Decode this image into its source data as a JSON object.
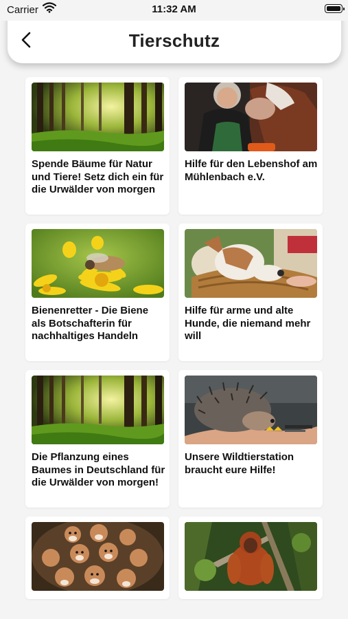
{
  "status_bar": {
    "carrier": "Carrier",
    "time": "11:32 AM"
  },
  "nav": {
    "title": "Tierschutz"
  },
  "cards": [
    {
      "title": "Spende Bäume für Natur und Tiere! Setz dich ein für die Urwälder von morgen",
      "image": "forest"
    },
    {
      "title": "Hilfe für den Lebenshof am Mühlenbach e.V.",
      "image": "man-with-cow"
    },
    {
      "title": "Bienenretter - Die Biene als Botschafterin für nachhaltiges Handeln",
      "image": "bee-on-flower"
    },
    {
      "title": "Hilfe für arme und alte Hunde, die niemand mehr will",
      "image": "dog-in-basket"
    },
    {
      "title": "Die Pflanzung eines Baumes in Deutschland für die Urwälder von morgen!",
      "image": "forest"
    },
    {
      "title": "Unsere Wildtierstation braucht eure Hilfe!",
      "image": "hedgehog-in-hand"
    },
    {
      "title": "",
      "image": "hamsters"
    },
    {
      "title": "",
      "image": "orangutan"
    }
  ]
}
